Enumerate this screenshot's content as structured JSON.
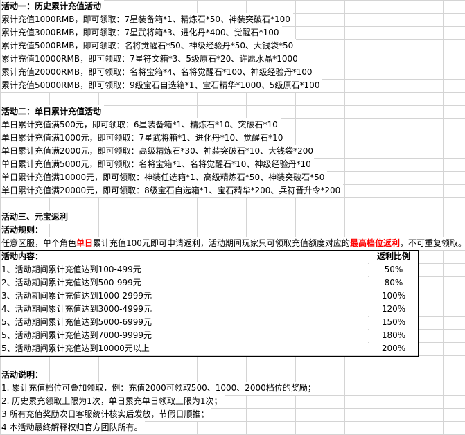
{
  "section1": {
    "title": "活动一：历史累计充值活动",
    "lines": [
      "累计充值1000RMB，即可领取：7星装备箱*1、精炼石*50、神装突破石*100",
      "累计充值3000RMB，即可领取：7星武将箱*3、进化丹*400、觉醒石*100",
      "累计充值5000RMB，即可领取：名将觉醒石*50、神级经验丹*50、大钱袋*50",
      "累计充值10000RMB，即可领取：7星符文箱*3、5级原石*20、许愿水晶*1000",
      "累计充值20000RMB，即可领取：名将宝箱*4、名将觉醒石*100、神级经验丹*100",
      "累计充值50000RMB，即可领取：9级宝石自选箱*1、宝石精华*1000、5级原石*100"
    ]
  },
  "section2": {
    "title": "活动二：单日累计充值活动",
    "lines": [
      "单日累计充值满500元，即可领取：6星装备箱*1、精炼石*10、突破石*10",
      "单日累计充值满1000元，即可领取：7星武将箱*1、进化丹*10、觉醒石*10",
      "单日累计充值满2000元，即可领取：高级精炼石*30、神装突破石*10、大钱袋*200",
      "单日累计充值满5000元，即可领取：名将宝箱*1、名将觉醒石*10、神级经验丹*10",
      "单日累计充值满10000元，即可领取：神装任选箱*1、高级精炼石*50、神装突破石*50",
      "单日累计充值满20000元，即可领取：8级宝石自选箱*1、宝石精华*200、兵符晋升令*200"
    ]
  },
  "section3": {
    "title": "活动三、元宝返利",
    "rules_title": "活动规则：",
    "rule_p1": "任意区服，单个角色",
    "rule_hi1": "单日",
    "rule_p2": "累计充值100元即可申请返利，活动期间玩家只可领取充值额度对应的",
    "rule_hi2": "最高档位返利",
    "rule_p3": "，不可重复领取。",
    "content_label": "活动内容：",
    "ratio_label": "返利比例",
    "tiers": [
      {
        "label": "1、活动期间累计充值达到100-499元",
        "ratio": "50%"
      },
      {
        "label": "2、活动期间累计充值达到500-999元",
        "ratio": "80%"
      },
      {
        "label": "3、活动期间累计充值达到1000-2999元",
        "ratio": "100%"
      },
      {
        "label": "4、活动期间累计充值达到3000-4999元",
        "ratio": "120%"
      },
      {
        "label": "5、活动期间累计充值达到5000-6999元",
        "ratio": "150%"
      },
      {
        "label": "5、活动期间累计充值达到7000-9999元",
        "ratio": "180%"
      },
      {
        "label": "5、活动期间累计充值达到10000元以上",
        "ratio": "200%"
      }
    ]
  },
  "notes": {
    "title": "活动说明：",
    "lines": [
      "1. 累计充值档位可叠加领取，例：充值2000可领取500、1000、2000档位的奖励；",
      "2. 历史累充领取上限为1次，单日累充单日领取上限为1次；",
      "3   所有充值奖励次日客服统计核实后发放，节假日顺推；",
      "4   本活动最终解释权归官方团队所有。"
    ]
  }
}
